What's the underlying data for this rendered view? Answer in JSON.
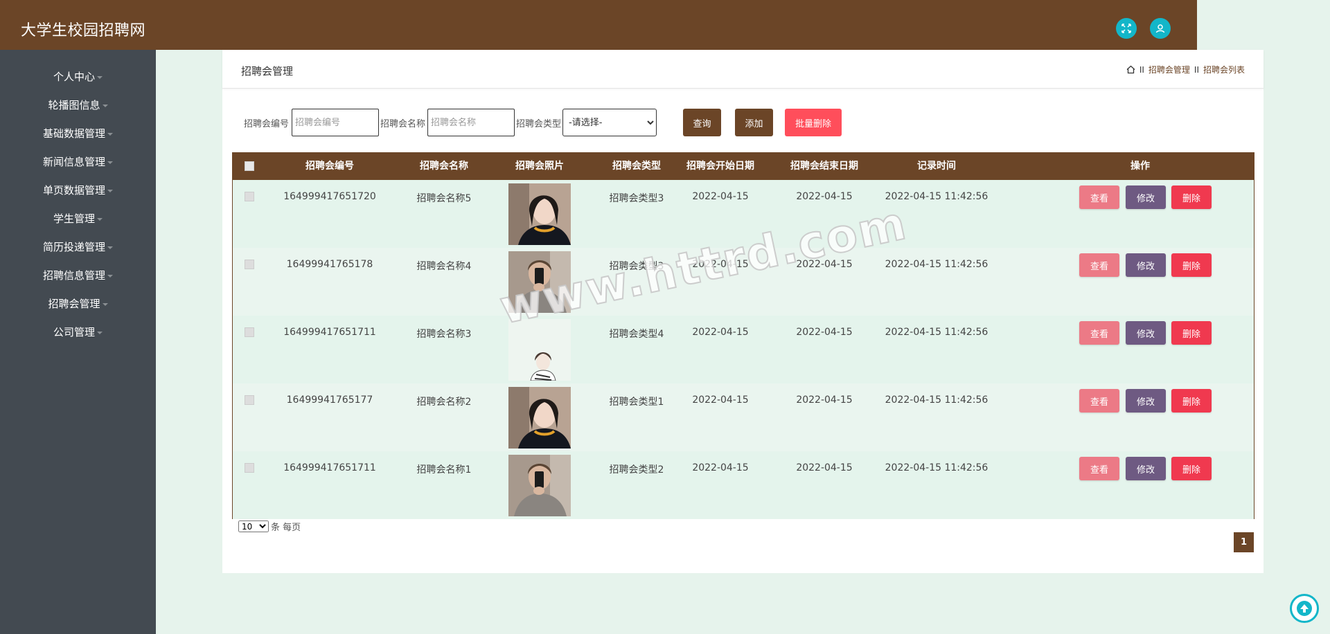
{
  "app": {
    "title": "大学生校园招聘网"
  },
  "sidebar": {
    "items": [
      {
        "label": "个人中心"
      },
      {
        "label": "轮播图信息"
      },
      {
        "label": "基础数据管理"
      },
      {
        "label": "新闻信息管理"
      },
      {
        "label": "单页数据管理"
      },
      {
        "label": "学生管理"
      },
      {
        "label": "简历投递管理"
      },
      {
        "label": "招聘信息管理"
      },
      {
        "label": "招聘会管理"
      },
      {
        "label": "公司管理"
      }
    ]
  },
  "page": {
    "title": "招聘会管理",
    "breadcrumb": {
      "sep": "II",
      "level1": "招聘会管理",
      "level2": "招聘会列表"
    }
  },
  "search": {
    "code_label": "招聘会编号",
    "code_placeholder": "招聘会编号",
    "name_label": "招聘会名称",
    "name_placeholder": "招聘会名称",
    "type_label": "招聘会类型",
    "type_selected": "-请选择-",
    "query_label": "查询",
    "add_label": "添加",
    "batch_delete_label": "批量删除"
  },
  "table": {
    "columns": [
      "招聘会编号",
      "招聘会名称",
      "招聘会照片",
      "招聘会类型",
      "招聘会开始日期",
      "招聘会结束日期",
      "记录时间",
      "操作"
    ],
    "actions": {
      "view": "查看",
      "edit": "修改",
      "delete": "删除"
    },
    "rows": [
      {
        "code": "164999417651720",
        "name": "招聘会名称5",
        "photo": "woman-portrait",
        "type": "招聘会类型3",
        "start": "2022-04-15",
        "end": "2022-04-15",
        "time": "2022-04-15 11:42:56"
      },
      {
        "code": "16499941765178",
        "name": "招聘会名称4",
        "photo": "man-selfie",
        "type": "招聘会类型3",
        "start": "2022-04-15",
        "end": "2022-04-15",
        "time": "2022-04-15 11:42:56"
      },
      {
        "code": "164999417651711",
        "name": "招聘会名称3",
        "photo": "girl-sketch",
        "type": "招聘会类型4",
        "start": "2022-04-15",
        "end": "2022-04-15",
        "time": "2022-04-15 11:42:56"
      },
      {
        "code": "16499941765177",
        "name": "招聘会名称2",
        "photo": "woman-portrait",
        "type": "招聘会类型1",
        "start": "2022-04-15",
        "end": "2022-04-15",
        "time": "2022-04-15 11:42:56"
      },
      {
        "code": "164999417651711",
        "name": "招聘会名称1",
        "photo": "man-selfie",
        "type": "招聘会类型2",
        "start": "2022-04-15",
        "end": "2022-04-15",
        "time": "2022-04-15 11:42:56"
      }
    ]
  },
  "pagination": {
    "page_size": "10",
    "page_size_suffix": "条 每页",
    "current_page": "1"
  },
  "watermark": "www.httrd.com",
  "colors": {
    "brand": "#6b4527",
    "sidebar": "#434a51",
    "accent_icon": "#13b6c9",
    "view_button": "#ec7a86",
    "edit_button": "#6e5a82",
    "delete_button": "#f0394f",
    "batch_delete": "#ff4e5b"
  }
}
